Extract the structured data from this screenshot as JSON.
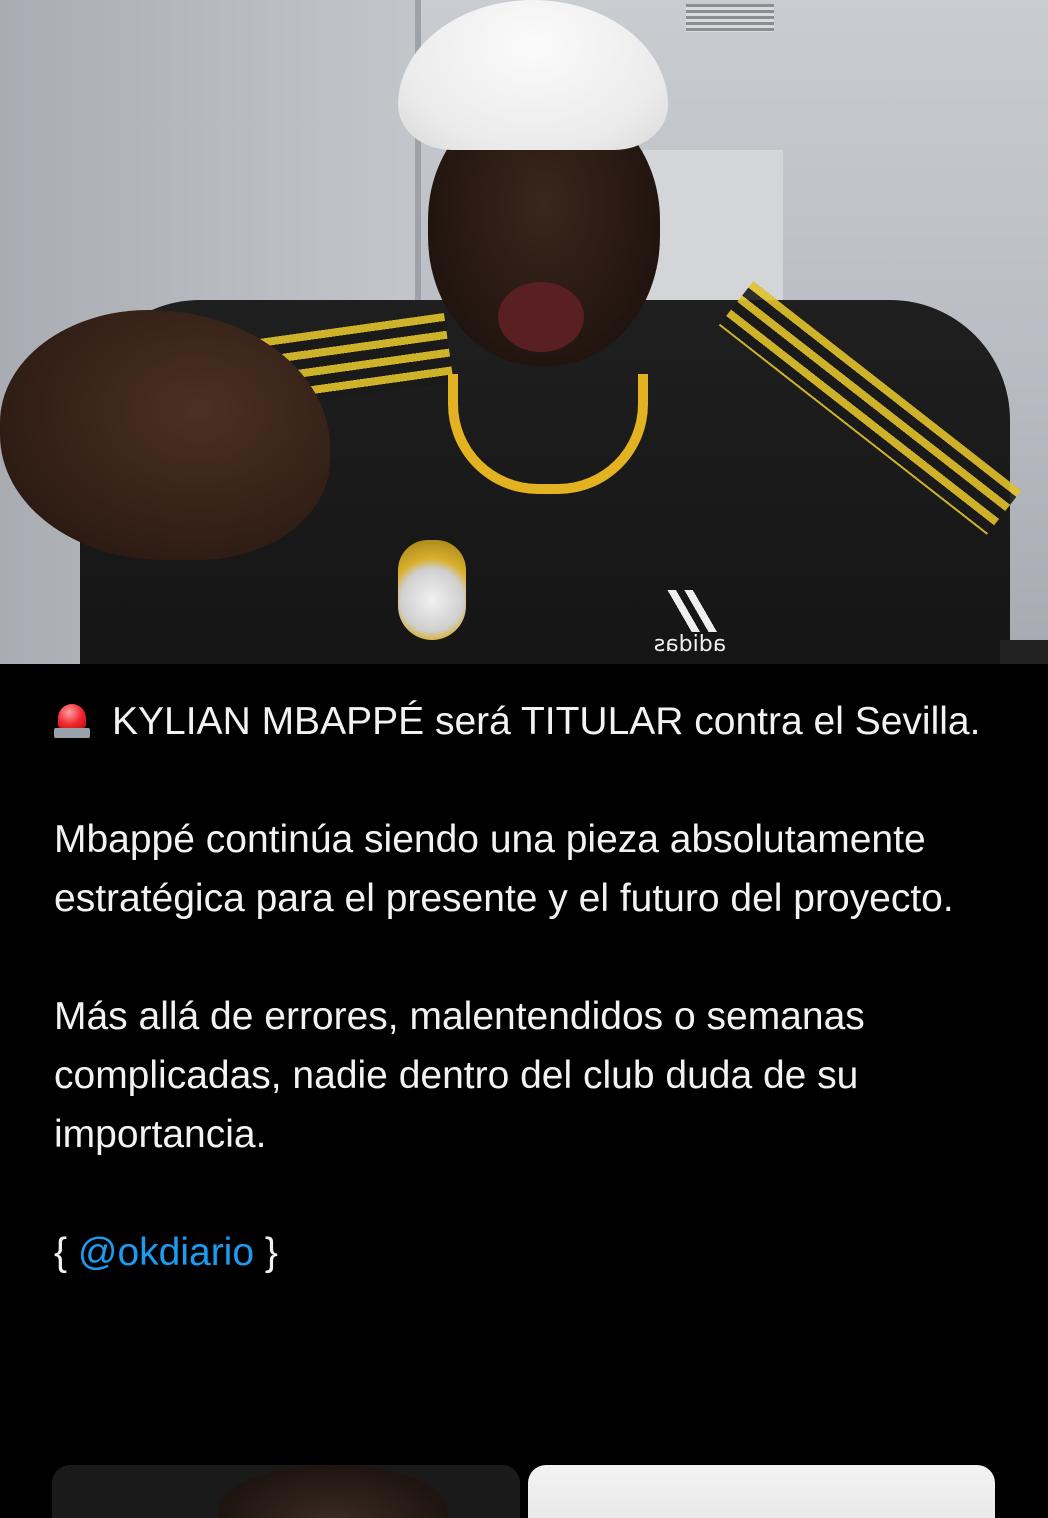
{
  "tweet": {
    "headline": "KYLIAN MBAPPÉ será TITULAR contra el Sevilla.",
    "paragraph_2": "Mbappé continúa siendo una pieza absolutamente estratégica para el presente y el futuro del proyecto.",
    "paragraph_3": "Más allá de errores, malentendidos o semanas complicadas, nadie dentro del club duda de su importancia.",
    "source_open": "{ ",
    "source_mention": "@okdiario",
    "source_close": " }",
    "headline_icon": "siren-icon",
    "mention_color": "#1d9bf0"
  },
  "video": {
    "jersey_brand": "adidas"
  }
}
